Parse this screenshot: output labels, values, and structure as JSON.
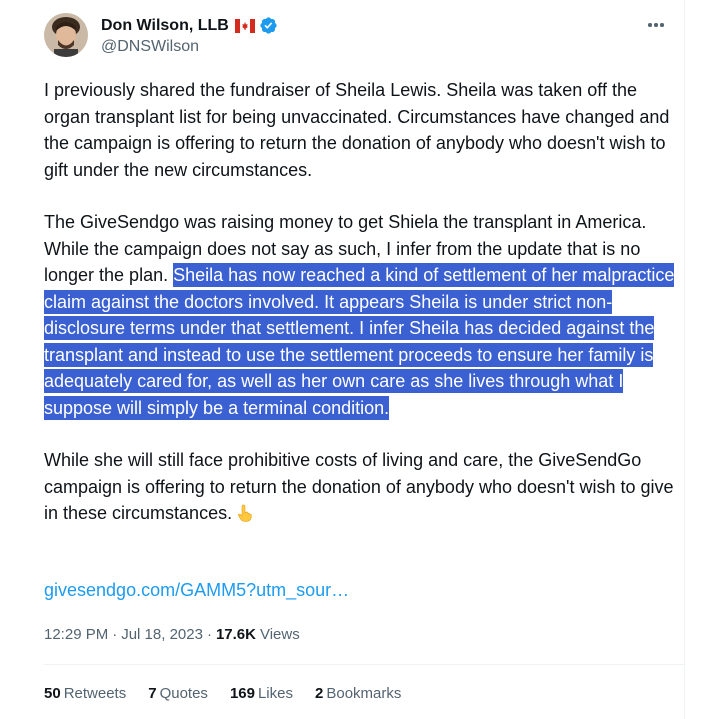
{
  "author": {
    "display_name": "Don Wilson, LLB",
    "handle": "@DNSWilson",
    "flag_icon": "canada-flag-icon",
    "verified_icon": "verified-badge-icon",
    "verified_color": "#1d9bf0"
  },
  "tweet": {
    "paragraph1": "I previously shared the fundraiser of Sheila Lewis. Sheila was taken off the organ transplant list for being unvaccinated. Circumstances have changed and the campaign is offering to return the donation of anybody who doesn't wish to gift under the new circumstances.",
    "paragraph2_plain": "The GiveSendgo was raising money to get Shiela the transplant in America. While the campaign does not say as such, I infer from the update that is no longer the plan.",
    "paragraph2_highlighted": "Sheila has now reached a kind of settlement of her malpractice claim against the doctors involved. It appears Sheila is under strict non-disclosure terms under that settlement. I infer Sheila has decided against the transplant and instead to use the settlement proceeds to ensure her family is adequately cared for, as well as her own care as she lives through what I suppose will simply be a terminal condition.",
    "paragraph3": "While she will still face prohibitive costs of living and care, the GiveSendGo campaign is offering to return the donation of anybody who doesn't wish to give in these circumstances.",
    "emoji_icon": "pointing-down-hand-icon",
    "link": "givesendgo.com/GAMM5?utm_sour…",
    "time": "12:29 PM",
    "date": "Jul 18, 2023",
    "views_count": "17.6K",
    "views_label": "Views",
    "separator": "·"
  },
  "stats": {
    "retweets_count": "50",
    "retweets_label": "Retweets",
    "quotes_count": "7",
    "quotes_label": "Quotes",
    "likes_count": "169",
    "likes_label": "Likes",
    "bookmarks_count": "2",
    "bookmarks_label": "Bookmarks"
  },
  "colors": {
    "selection": "#3a60d2",
    "link": "#1d9bf0",
    "secondary_text": "#536471"
  }
}
